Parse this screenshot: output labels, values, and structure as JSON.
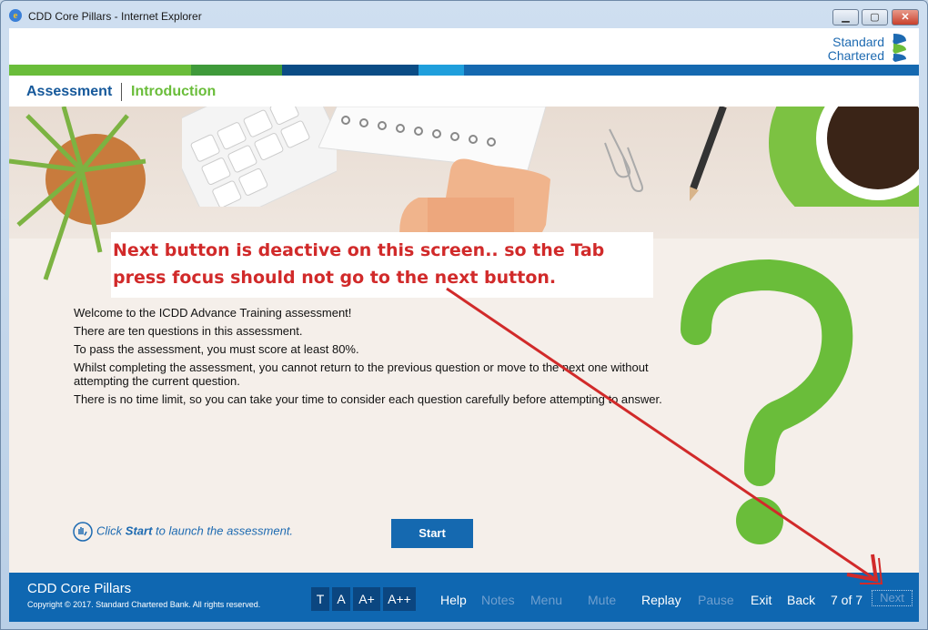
{
  "window": {
    "title": "CDD Core Pillars - Internet Explorer",
    "min": "▁",
    "max": "▢",
    "close": "✕"
  },
  "header": {
    "logo_line1": "Standard",
    "logo_line2": "Chartered"
  },
  "stripes": [
    "#6abd3a",
    "#3f9a3a",
    "#0b4c85",
    "#0b4c85",
    "#1f9fdc",
    "#1569b0"
  ],
  "nav": {
    "assessment": "Assessment",
    "introduction": "Introduction"
  },
  "annotation": {
    "line1": "Next button is deactive on this screen.. so the Tab",
    "line2": "press focus should not go to the next button."
  },
  "intro": {
    "p1": "Welcome to the ICDD Advance Training assessment!",
    "p2": "There are ten questions in this assessment.",
    "p3": "To pass the assessment, you must score at least 80%.",
    "p4": "Whilst completing the assessment, you cannot return to the previous question or move to the next one without attempting the current question.",
    "p5": "There is no time limit, so you can take your time to consider each question carefully before attempting to answer."
  },
  "hint": {
    "pre": "Click ",
    "bold": "Start",
    "post": " to launch the assessment."
  },
  "start_label": "Start",
  "footer": {
    "course_title": "CDD Core Pillars",
    "copyright": "Copyright © 2017. Standard Chartered Bank. All rights reserved.",
    "font_sizes": [
      "T",
      "A",
      "A+",
      "A++"
    ],
    "help": "Help",
    "notes": "Notes",
    "menu": "Menu",
    "mute": "Mute",
    "replay": "Replay",
    "pause": "Pause",
    "exit": "Exit",
    "back": "Back",
    "page": "7 of 7",
    "next": "Next"
  },
  "colors": {
    "brand_blue": "#1569b0",
    "brand_green": "#6abd3a",
    "annotation_red": "#d12a2a"
  }
}
